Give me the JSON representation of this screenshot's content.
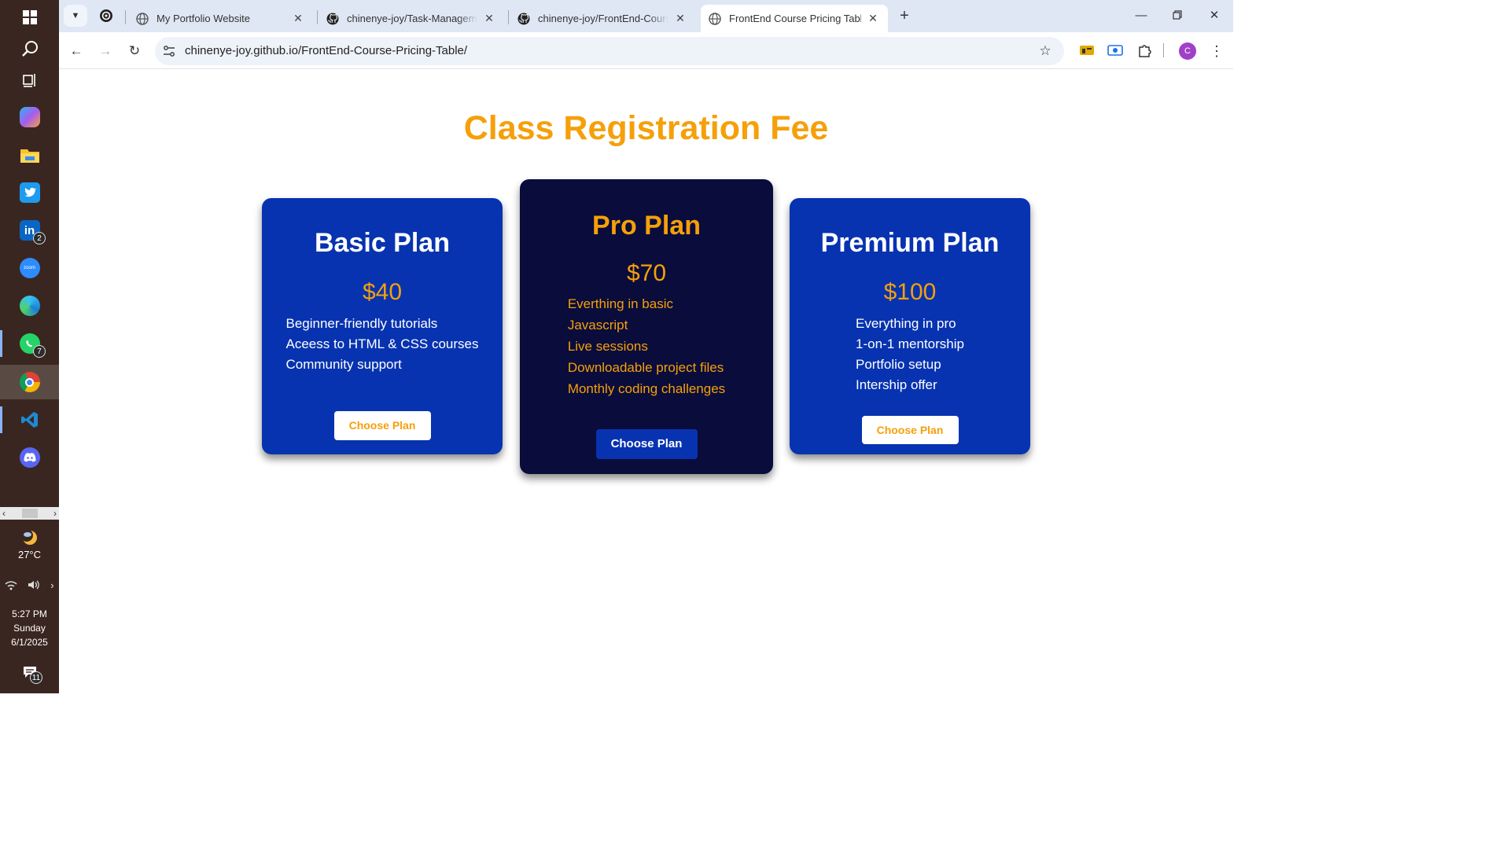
{
  "taskbar": {
    "icons": [
      "windows-start-icon",
      "search-icon",
      "task-view-icon",
      "copilot-icon",
      "file-explorer-icon",
      "twitter-icon",
      "linkedin-icon",
      "zoom-icon",
      "edge-icon",
      "whatsapp-icon",
      "chrome-icon",
      "vscode-icon",
      "discord-icon"
    ],
    "linkedin_badge": "2",
    "whatsapp_badge": "7",
    "weather_temp": "27°C",
    "clock_time": "5:27 PM",
    "clock_day": "Sunday",
    "clock_date": "6/1/2025",
    "notification_count": "11"
  },
  "browser": {
    "tabs": [
      {
        "title": "My Portfolio Website",
        "icon": "globe-icon"
      },
      {
        "title": "chinenye-joy/Task-Management",
        "icon": "github-icon"
      },
      {
        "title": "chinenye-joy/FrontEnd-Course-",
        "icon": "github-icon"
      },
      {
        "title": "FrontEnd Course Pricing Table",
        "icon": "globe-icon",
        "active": true
      }
    ],
    "url_host": "chinenye-joy.github.io",
    "url_path": "/FrontEnd-Course-Pricing-Table/",
    "avatar_letter": "C"
  },
  "page": {
    "title": "Class Registration Fee",
    "plans": [
      {
        "name": "Basic Plan",
        "price": "$40",
        "features": [
          "Beginner-friendly tutorials",
          "Aceess to HTML & CSS courses",
          "Community support"
        ],
        "button": "Choose Plan"
      },
      {
        "name": "Pro Plan",
        "price": "$70",
        "features": [
          "Everthing in basic",
          "Javascript",
          "Live sessions",
          "Downloadable project files",
          "Monthly coding challenges"
        ],
        "button": "Choose Plan"
      },
      {
        "name": "Premium Plan",
        "price": "$100",
        "features": [
          "Everything in pro",
          "1-on-1 mentorship",
          "Portfolio setup",
          "Intership offer"
        ],
        "button": "Choose Plan"
      }
    ]
  },
  "colors": {
    "accent": "#f5a00a",
    "card_blue": "#0733b0",
    "card_dark": "#0a0c3b",
    "taskbar": "#3a2620"
  }
}
